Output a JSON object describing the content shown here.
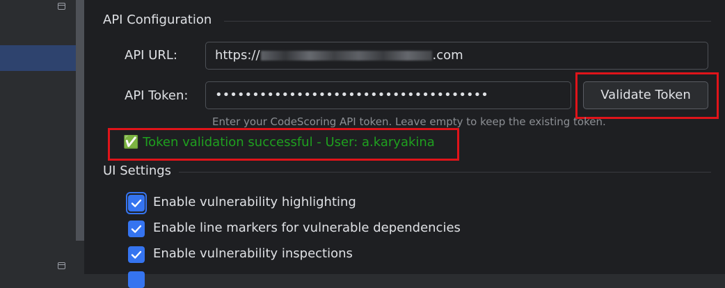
{
  "api_section": {
    "title": "API Configuration",
    "url_label": "API URL:",
    "url_prefix": "https://",
    "url_suffix": ".com",
    "token_label": "API Token:",
    "token_value": "•••••••••••••••••••••••••••••••••••••",
    "validate_button": "Validate Token",
    "token_hint": "Enter your CodeScoring API token. Leave empty to keep the existing token.",
    "validation_message": "✅ Token validation successful - User: a.karyakina"
  },
  "ui_section": {
    "title": "UI Settings",
    "options": [
      {
        "label": "Enable vulnerability highlighting",
        "checked": true
      },
      {
        "label": "Enable line markers for vulnerable dependencies",
        "checked": true
      },
      {
        "label": "Enable vulnerability inspections",
        "checked": true
      }
    ]
  },
  "colors": {
    "accent": "#3574f0",
    "success": "#1fa01f",
    "highlight_box": "#e0141a",
    "background": "#1e1f22"
  }
}
